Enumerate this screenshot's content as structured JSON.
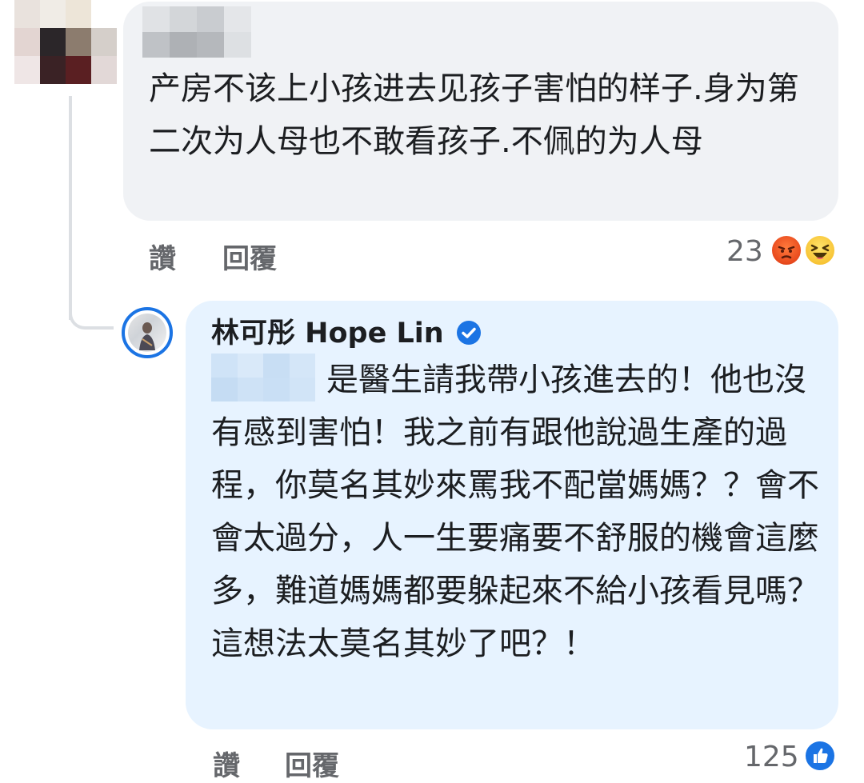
{
  "comment": {
    "text": "产房不该上小孩进去见孩子害怕的样子.身为第二次为人母也不敢看孩子.不佩的为人母",
    "actions": {
      "like_label": "讚",
      "reply_label": "回覆"
    },
    "reaction_count": "23",
    "reaction_icons": [
      "angry-emoji",
      "haha-emoji"
    ]
  },
  "reply": {
    "author": "林可彤 Hope Lin",
    "verified": true,
    "text": "是醫生請我帶小孩進去的！他也沒有感到害怕！我之前有跟他說過生產的過程，你莫名其妙來罵我不配當媽媽？？會不會太過分，人一生要痛要不舒服的機會這麼多，難道媽媽都要躲起來不給小孩看見嗎？這想法太莫名其妙了吧？！",
    "actions": {
      "like_label": "讚",
      "reply_label": "回覆"
    },
    "reaction_count": "125",
    "reaction_icons": [
      "like-icon"
    ]
  },
  "colors": {
    "comment_bubble": "#f0f2f5",
    "reply_bubble": "#e7f3ff",
    "accent": "#1b74e4",
    "secondary_text": "#65676b"
  }
}
